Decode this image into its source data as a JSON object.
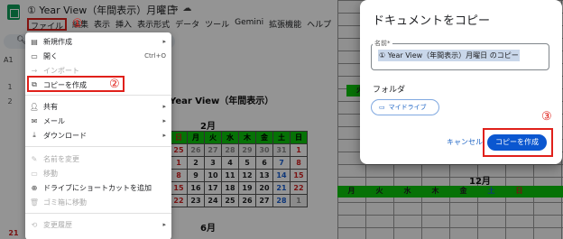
{
  "header": {
    "doc_title": "① Year View（年間表示）月曜日",
    "title_icons": [
      "star-icon",
      "move-icon",
      "cloud-icon"
    ],
    "menu": [
      "ファイル",
      "編集",
      "表示",
      "挿入",
      "表示形式",
      "データ",
      "ツール",
      "Gemini",
      "拡張機能",
      "ヘルプ"
    ],
    "cell_ref": "A1",
    "rows": [
      "1",
      "2"
    ]
  },
  "sheet": {
    "title": "Year View（年間表示）",
    "month1": "2月",
    "month2": "6月",
    "month3": "12月",
    "weekdays": [
      "月",
      "火",
      "水",
      "木",
      "金",
      "土",
      "日"
    ],
    "feb_rows": [
      [
        "26",
        "27",
        "28",
        "29",
        "30",
        "31",
        "1"
      ],
      [
        "2",
        "3",
        "4",
        "5",
        "6",
        "7",
        "8"
      ],
      [
        "9",
        "10",
        "11",
        "12",
        "13",
        "14",
        "15"
      ],
      [
        "16",
        "17",
        "18",
        "19",
        "20",
        "21",
        "22"
      ],
      [
        "23",
        "24",
        "25",
        "26",
        "27",
        "28",
        "1"
      ],
      [
        "2",
        "3",
        "4",
        "5",
        "6",
        "7",
        "8"
      ]
    ],
    "bottom_row": [
      "21",
      "22",
      "23",
      "24",
      "25",
      "26",
      "27"
    ]
  },
  "file_menu": {
    "items": [
      {
        "label": "新規作成",
        "icon": "new-doc-icon",
        "arrow": "▸"
      },
      {
        "label": "開く",
        "icon": "folder-icon",
        "shortcut": "Ctrl+O"
      },
      {
        "label": "インポート",
        "icon": "import-icon"
      },
      {
        "label": "コピーを作成",
        "icon": "copy-icon"
      },
      {
        "label": "共有",
        "icon": "person-add-icon",
        "arrow": "▸"
      },
      {
        "label": "メール",
        "icon": "mail-icon",
        "arrow": "▸"
      },
      {
        "label": "ダウンロード",
        "icon": "download-icon",
        "arrow": "▸"
      },
      {
        "label": "名前を変更",
        "icon": "pencil-icon"
      },
      {
        "label": "移動",
        "icon": "move-icon"
      },
      {
        "label": "ドライブにショートカットを追加",
        "icon": "drive-shortcut-icon"
      },
      {
        "label": "ゴミ箱に移動",
        "icon": "trash-icon"
      },
      {
        "label": "変更履歴",
        "icon": "history-icon",
        "arrow": "▸"
      }
    ]
  },
  "annotations": {
    "one": "①",
    "two": "②",
    "three": "③"
  },
  "dialog": {
    "title": "ドキュメントをコピー",
    "name_label": "名前*",
    "name_value": "① Year View（年間表示）月曜日 のコピー",
    "folder_label": "フォルダ",
    "drive_chip": "マイドライブ",
    "cancel": "キャンセル",
    "copy": "コピーを作成"
  },
  "colors": {
    "accent": "#0b57d0",
    "highlight": "#e0201a",
    "header_green": "#0cc40c"
  }
}
